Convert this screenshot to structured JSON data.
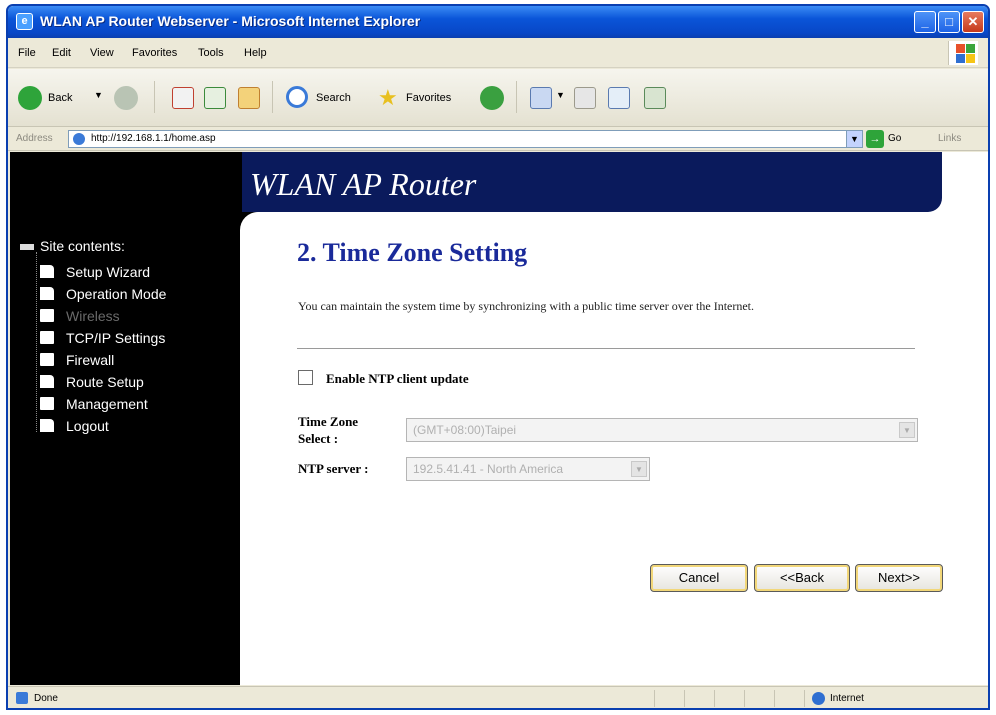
{
  "window": {
    "title": "WLAN AP Router Webserver - Microsoft Internet Explorer",
    "buttons": {
      "minimize": "_",
      "maximize": "□",
      "close": "✕"
    }
  },
  "menu": [
    "File",
    "Edit",
    "View",
    "Favorites",
    "Tools",
    "Help"
  ],
  "toolbar": {
    "back": "Back",
    "search": "Search",
    "favorites": "Favorites"
  },
  "address": {
    "label": "Address",
    "url": "http://192.168.1.1/home.asp",
    "go": "Go",
    "links": "Links"
  },
  "banner": {
    "title": "WLAN AP Router"
  },
  "sidebar": {
    "title": "Site contents:",
    "items": [
      {
        "label": "Setup Wizard",
        "icon": "page-icon"
      },
      {
        "label": "Operation Mode",
        "icon": "page-icon"
      },
      {
        "label": "Wireless",
        "icon": "folder-icon"
      },
      {
        "label": "TCP/IP Settings",
        "icon": "folder-icon"
      },
      {
        "label": "Firewall",
        "icon": "folder-icon"
      },
      {
        "label": "Route Setup",
        "icon": "page-icon"
      },
      {
        "label": "Management",
        "icon": "folder-icon"
      },
      {
        "label": "Logout",
        "icon": "page-icon"
      }
    ]
  },
  "main": {
    "title": "2. Time Zone Setting",
    "description": "You can maintain the system time by synchronizing with a public time server over the Internet.",
    "ntp_checkbox_label": "Enable NTP client update",
    "timezone_label_line1": "Time Zone",
    "timezone_label_line2": "Select :",
    "timezone_value": "(GMT+08:00)Taipei",
    "ntp_server_label": "NTP server :",
    "ntp_server_value": "192.5.41.41 - North America",
    "cancel_button": "Cancel",
    "back_button": "<<Back",
    "next_button": "Next>>"
  },
  "status": {
    "text": "Done",
    "zone": "Internet"
  },
  "colors": {
    "title_bar": "#0a55d8",
    "banner": "#0a1a5c",
    "heading": "#1a2a9a",
    "sidebar_bg": "#000000"
  }
}
